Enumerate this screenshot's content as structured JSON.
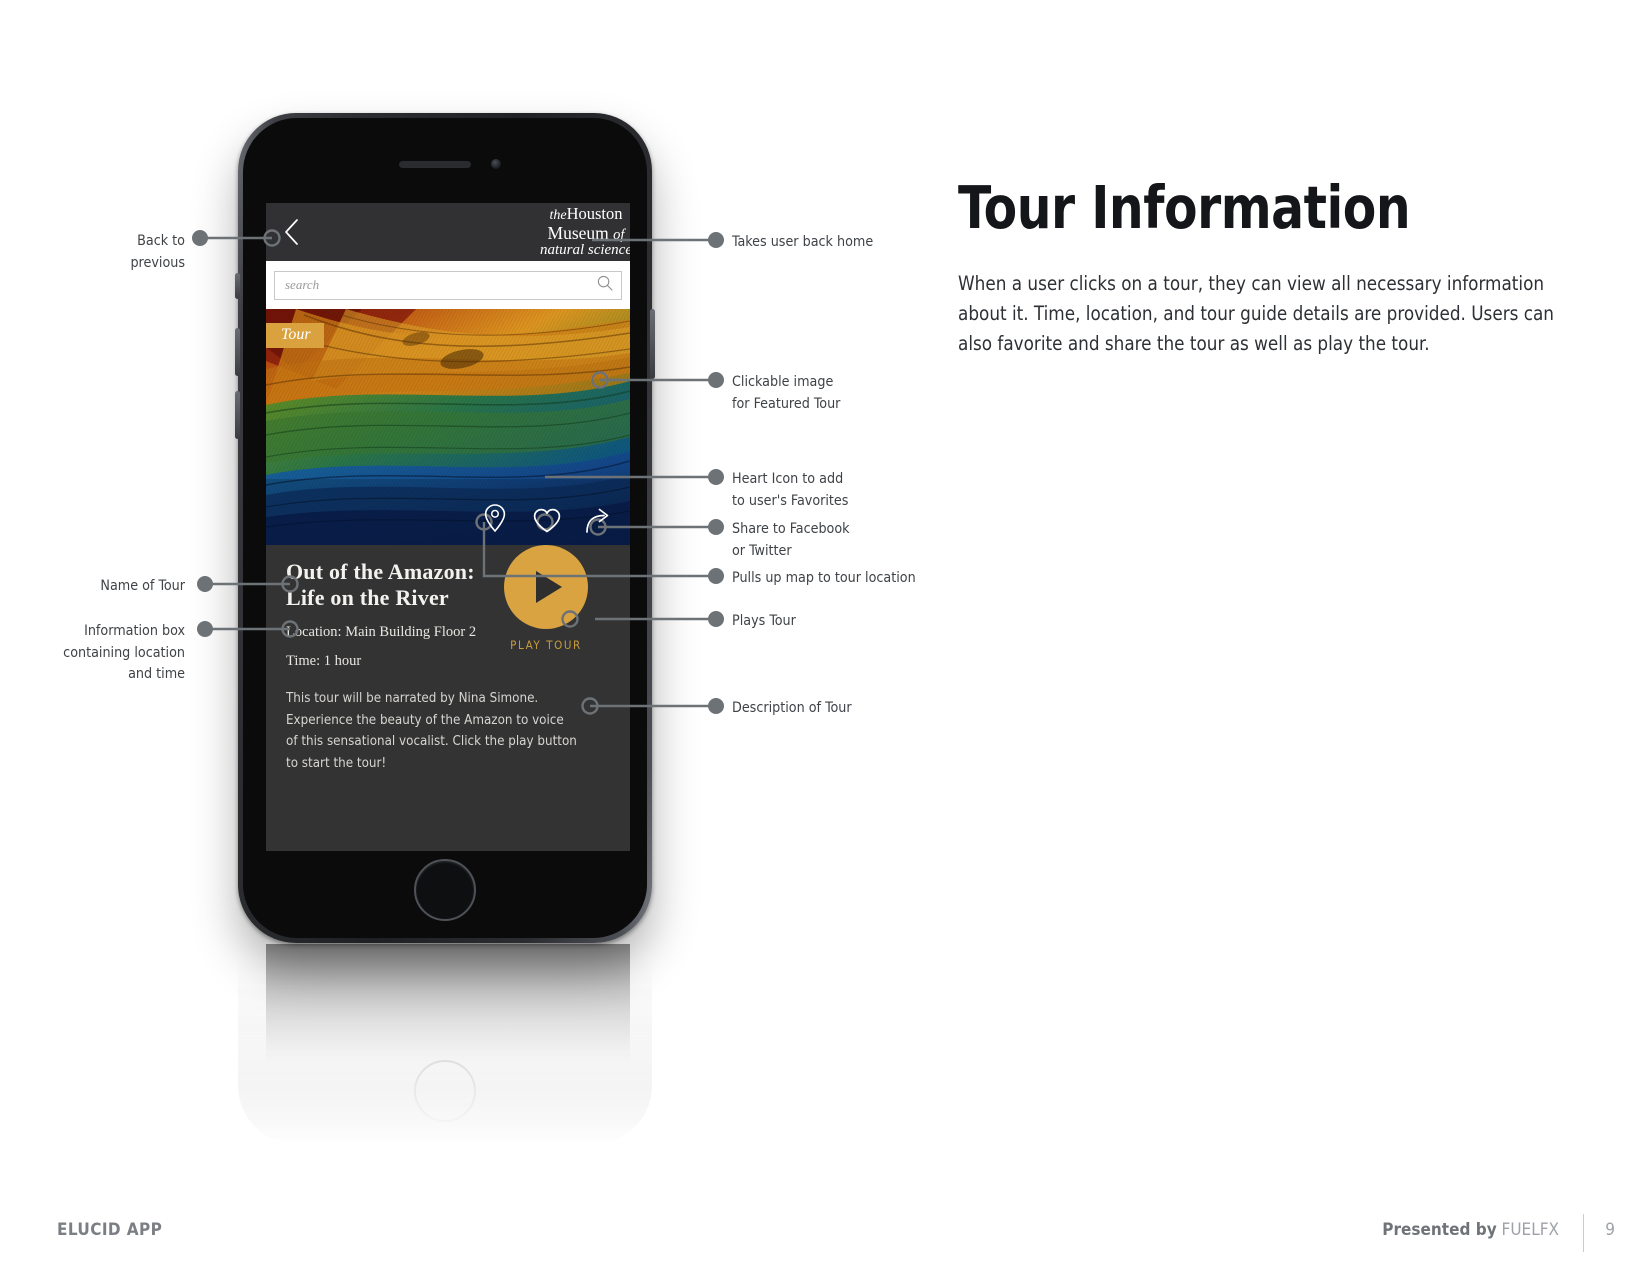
{
  "article": {
    "title": "Tour Information",
    "body": "When a user clicks on a tour, they can view all necessary information about it. Time, location, and tour guide details are provided. Users can also favorite and share the tour as well as play the tour."
  },
  "phone": {
    "header": {
      "back_icon": "chevron-left-icon",
      "logo": {
        "line1_italic": "the",
        "line1": "Houston",
        "line2": "Museum",
        "line2_italic": "of",
        "line3": "natural science"
      }
    },
    "search": {
      "placeholder": "search",
      "icon": "search-icon"
    },
    "hero": {
      "badge": "Tour",
      "icons": [
        "map-pin-icon",
        "heart-icon",
        "share-icon"
      ]
    },
    "detail": {
      "title": "Out of the Amazon: Life on the River",
      "location": "Location: Main Building Floor 2",
      "time": "Time: 1 hour",
      "description": "This tour will be narrated by Nina Simone. Experience the beauty of the Amazon to voice of this sensational vocalist. Click the play button to start the tour!",
      "play_label": "PLAY TOUR",
      "play_icon": "play-triangle-icon"
    }
  },
  "callouts": {
    "left": [
      {
        "id": "back-to-previous",
        "text": "Back to\nprevious"
      },
      {
        "id": "name-of-tour",
        "text": "Name of Tour"
      },
      {
        "id": "information-box",
        "text": "Information box\ncontaining location\nand time"
      }
    ],
    "right": [
      {
        "id": "takes-user-back-home",
        "text": "Takes user back home"
      },
      {
        "id": "clickable-image",
        "text": "Clickable image\nfor Featured Tour"
      },
      {
        "id": "heart-icon-favorites",
        "text": "Heart Icon to add\nto user's Favorites"
      },
      {
        "id": "share-social",
        "text": "Share to Facebook\nor Twitter"
      },
      {
        "id": "pulls-up-map",
        "text": "Pulls up map to tour location"
      },
      {
        "id": "plays-tour",
        "text": "Plays Tour"
      },
      {
        "id": "description-of-tour",
        "text": "Description of Tour"
      }
    ]
  },
  "footer": {
    "left": "ELUCID APP",
    "presented_by": "Presented by",
    "brand": "FUELFX",
    "page_number": "9"
  },
  "colors": {
    "accent_gold": "#d9a341",
    "panel_dark": "#333333",
    "header_dark": "#313133",
    "callout_gray": "#6d7276"
  }
}
